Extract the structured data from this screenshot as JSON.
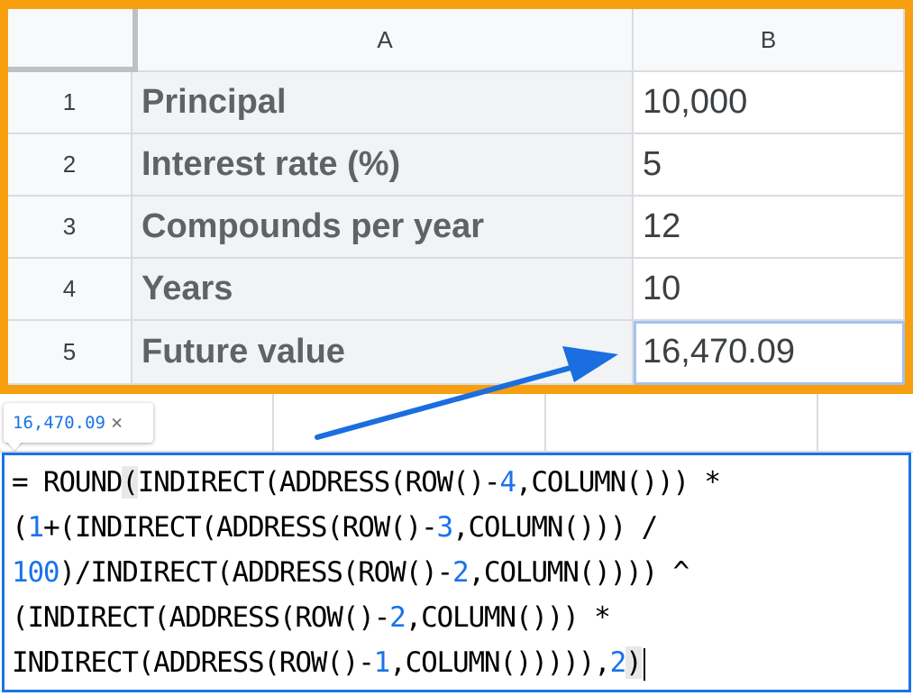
{
  "sheet": {
    "corner": "",
    "columns": [
      "A",
      "B"
    ],
    "rows": [
      {
        "num": "1",
        "label": "Principal",
        "value": "10,000"
      },
      {
        "num": "2",
        "label": "Interest rate (%)",
        "value": "5"
      },
      {
        "num": "3",
        "label": "Compounds per year",
        "value": "12"
      },
      {
        "num": "4",
        "label": "Years",
        "value": "10"
      },
      {
        "num": "5",
        "label": "Future value",
        "value": "16,470.09"
      }
    ]
  },
  "tooltip": {
    "value": "16,470.09",
    "close_icon": "×"
  },
  "formula": {
    "l1": {
      "a": "= ROUND",
      "b": "(",
      "c": "INDIRECT(ADDRESS(ROW()-",
      "d": "4",
      "e": ",COLUMN())) *"
    },
    "l2": {
      "a": "(",
      "b": "1",
      "c": "+(INDIRECT(ADDRESS(ROW()-",
      "d": "3",
      "e": ",COLUMN())) /"
    },
    "l3": {
      "a": "100",
      "b": ")/INDIRECT(ADDRESS(ROW()-",
      "c": "2",
      "d": ",COLUMN()))) ^"
    },
    "l4": {
      "a": "(INDIRECT(ADDRESS(ROW()-",
      "b": "2",
      "c": ",COLUMN())) *"
    },
    "l5": {
      "a": "INDIRECT(ADDRESS(ROW()-",
      "b": "1",
      "c": ",COLUMN())))),",
      "d": "2",
      "e": ")"
    }
  },
  "colors": {
    "frame": "#f79f0e",
    "selection": "#1a73e8",
    "arrow": "#1a6ee0"
  },
  "icons": [
    "close-icon",
    "arrow-icon",
    "text-caret"
  ]
}
